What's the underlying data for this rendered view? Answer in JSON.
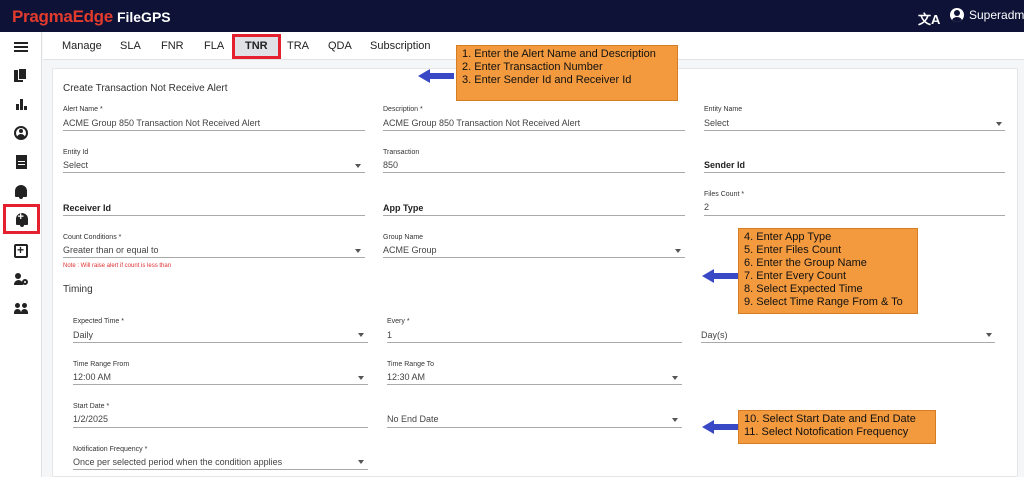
{
  "header": {
    "brand": "PragmaEdge",
    "app": "FileGPS",
    "translate_glyph": "文A",
    "user": "Superadmin"
  },
  "sidebar": {
    "icons": [
      "menu-icon",
      "documents-icon",
      "bar-chart-icon",
      "account-icon",
      "report-icon",
      "alert-bell-icon",
      "add-alert-icon",
      "medical-services-icon",
      "user-settings-icon",
      "group-icon"
    ],
    "active": "add-alert-icon"
  },
  "tabs": [
    {
      "label": "Manage"
    },
    {
      "label": "SLA"
    },
    {
      "label": "FNR"
    },
    {
      "label": "FLA"
    },
    {
      "label": "TNR",
      "active": true
    },
    {
      "label": "TRA"
    },
    {
      "label": "QDA"
    },
    {
      "label": "Subscription"
    }
  ],
  "form": {
    "title": "Create Transaction Not Receive Alert",
    "alert_name": {
      "label": "Alert Name *",
      "value": "ACME Group 850 Transaction Not Received Alert"
    },
    "description": {
      "label": "Description *",
      "value": "ACME Group 850 Transaction Not Received Alert"
    },
    "entity_name": {
      "label": "Entity Name",
      "value": "Select"
    },
    "entity_id": {
      "label": "Entity Id",
      "value": "Select"
    },
    "transaction": {
      "label": "Transaction",
      "value": "850"
    },
    "sender_id": {
      "label": "Sender Id"
    },
    "receiver_id": {
      "label": "Receiver Id"
    },
    "app_type": {
      "label": "App Type"
    },
    "files_count": {
      "label": "Files Count *",
      "value": "2"
    },
    "count_conditions": {
      "label": "Count Conditions *",
      "value": "Greater than or equal to",
      "note": "Note : Will raise alert if count is less than"
    },
    "group_name": {
      "label": "Group Name",
      "value": "ACME Group"
    }
  },
  "timing": {
    "title": "Timing",
    "expected_time": {
      "label": "Expected Time *",
      "value": "Daily"
    },
    "every": {
      "label": "Every *",
      "value": "1"
    },
    "period": {
      "value": "Day(s)"
    },
    "time_from": {
      "label": "Time Range From",
      "value": "12:00 AM"
    },
    "time_to": {
      "label": "Time Range To",
      "value": "12:30 AM"
    },
    "start_date": {
      "label": "Start Date *",
      "value": "1/2/2025"
    },
    "end_date": {
      "value": "No End Date"
    },
    "notification_frequency": {
      "label": "Notification Frequency *",
      "value": "Once per selected period when the condition applies"
    }
  },
  "annotations": {
    "box1": [
      "1. Enter the Alert Name and Description",
      "2. Enter Transaction Number",
      "3. Enter Sender Id and Receiver Id"
    ],
    "box2": [
      "4. Enter App Type",
      "5. Enter Files Count",
      "6. Enter the Group Name",
      "7. Enter Every Count",
      "8. Select Expected Time",
      "9. Select Time Range From & To"
    ],
    "box3": [
      "10. Select Start Date and End Date",
      "11. Select Notofication Frequency"
    ],
    "colors": {
      "callout": "#f39a3e",
      "arrow": "#3949c6",
      "highlight": "#e4202f"
    }
  }
}
